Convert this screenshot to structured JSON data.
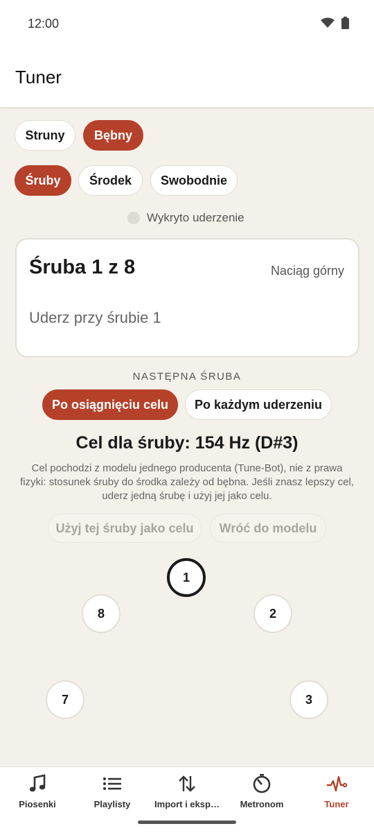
{
  "status": {
    "time": "12:00"
  },
  "app": {
    "title": "Tuner"
  },
  "instrument_tabs": [
    "Struny",
    "Bębny"
  ],
  "mode_tabs": [
    "Śruby",
    "Środek",
    "Swobodnie"
  ],
  "detection": {
    "label": "Wykryto uderzenie"
  },
  "card": {
    "bolt_title": "Śruba 1 z 8",
    "head_mode": "Naciąg górny",
    "hint": "Uderz przy śrubie 1"
  },
  "next_bolt": {
    "label": "NASTĘPNA ŚRUBA",
    "options": [
      "Po osiągnięciu celu",
      "Po każdym uderzeniu"
    ]
  },
  "target": {
    "title": "Cel dla śruby: 154 Hz (D#3)",
    "note": "Cel pochodzi z modelu jednego producenta (Tune-Bot), nie z prawa fizyki: stosunek śruby do środka zależy od bębna. Jeśli znasz lepszy cel, uderz jedną śrubę i użyj jej jako celu."
  },
  "actions": {
    "use_bolt": "Użyj tej śruby jako celu",
    "back_to_model": "Wróć do modelu"
  },
  "lugs": [
    "1",
    "2",
    "3",
    "7",
    "8"
  ],
  "nav": [
    {
      "label": "Piosenki",
      "icon": "music-note-icon"
    },
    {
      "label": "Playlisty",
      "icon": "list-icon"
    },
    {
      "label": "Import i eksp…",
      "icon": "import-export-icon"
    },
    {
      "label": "Metronom",
      "icon": "metronome-icon"
    },
    {
      "label": "Tuner",
      "icon": "waveform-icon"
    }
  ],
  "colors": {
    "accent": "#b5412a",
    "background": "#f4f1ea"
  }
}
